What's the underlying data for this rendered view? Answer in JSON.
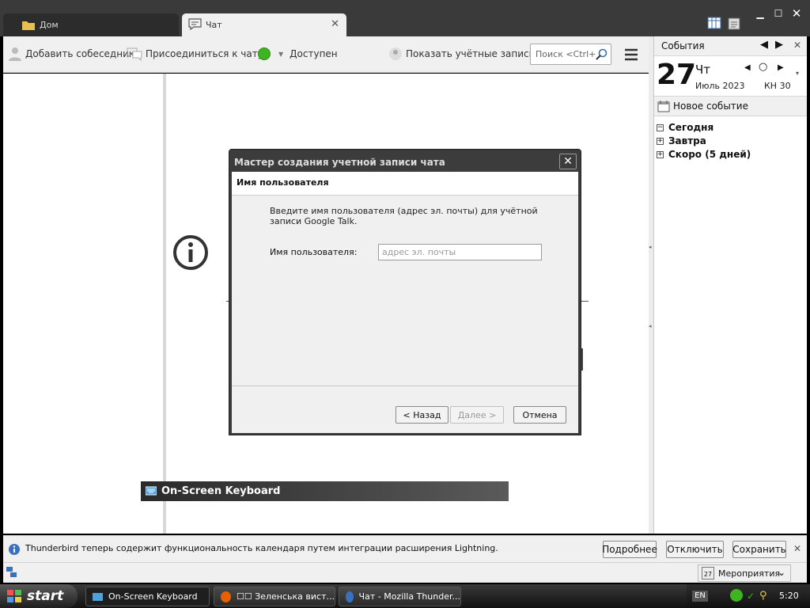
{
  "tabs": [
    {
      "label": "Дом",
      "icon": "folder-icon"
    },
    {
      "label": "Чат",
      "icon": "chat-bubble-icon"
    }
  ],
  "toolbar": {
    "add_contact": "Добавить собеседника",
    "join_chat": "Присоединиться к чату",
    "status": "Доступен",
    "show_accounts": "Показать учётные записи",
    "search_placeholder": "Поиск <Ctrl+K>"
  },
  "sidebar": {
    "title": "События",
    "day": "27",
    "weekday": "Чт",
    "month_year": "Июль 2023",
    "week": "КН 30",
    "new_event": "Новое событие",
    "groups": [
      {
        "label": "Сегодня",
        "expanded": true
      },
      {
        "label": "Завтра",
        "expanded": false
      },
      {
        "label": "Скоро (5 дней)",
        "expanded": false
      }
    ]
  },
  "dialog": {
    "title": "Мастер создания учетной записи чата",
    "heading": "Имя пользователя",
    "instruction": "Введите имя пользователя (адрес эл. почты) для учётной записи Google Talk.",
    "username_label": "Имя пользователя:",
    "username_placeholder": "адрес эл. почты",
    "back": "< Назад",
    "next": "Далее >",
    "cancel": "Отмена"
  },
  "osk_title": "On-Screen Keyboard",
  "notification": {
    "text": "Thunderbird теперь содержит функциональность календаря путем интеграции расширения Lightning.",
    "more": "Подробнее",
    "disable": "Отключить",
    "keep": "Сохранить"
  },
  "statusbar": {
    "events": "Мероприятия",
    "cal_day": "27"
  },
  "taskbar": {
    "start": "start",
    "items": [
      "On-Screen Keyboard",
      "☐☐ Зеленська вист...",
      "Чат - Mozilla Thunder..."
    ],
    "lang": "EN",
    "time": "5:20"
  },
  "colors": {
    "status_available": "#3cb521",
    "info_icon": "#3a70c0"
  }
}
